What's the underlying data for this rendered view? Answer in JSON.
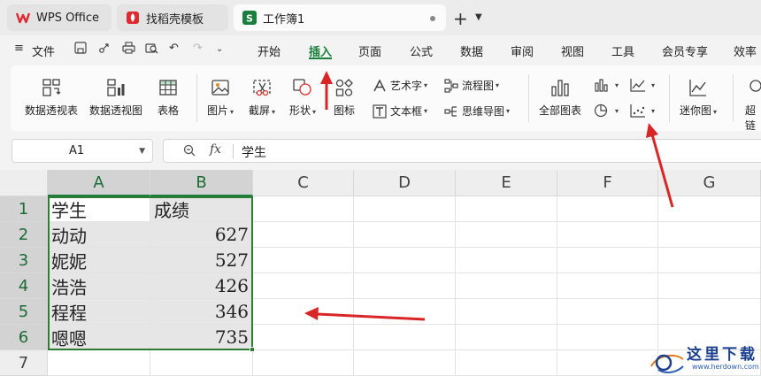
{
  "tabs": [
    {
      "label": "WPS Office",
      "icon": "wps-logo-icon"
    },
    {
      "label": "找稻壳模板",
      "icon": "docer-icon"
    },
    {
      "label": "工作簿1",
      "icon": "spreadsheet-icon"
    }
  ],
  "menu": {
    "file": "文件",
    "items": [
      "开始",
      "插入",
      "页面",
      "公式",
      "数据",
      "审阅",
      "视图",
      "工具",
      "会员专享",
      "效率"
    ],
    "active": "插入"
  },
  "ribbon": {
    "pivot_table": "数据透视表",
    "pivot_chart": "数据透视图",
    "table": "表格",
    "picture": "图片",
    "screenshot": "截屏",
    "shape": "形状",
    "icon": "图标",
    "wordart": "艺术字",
    "textbox": "文本框",
    "flowchart": "流程图",
    "mindmap": "思维导图",
    "all_charts": "全部图表",
    "sparkline": "迷你图",
    "cut_off": "超链"
  },
  "formula_bar": {
    "cell_ref": "A1",
    "fx": "fx",
    "content": "学生"
  },
  "sheet": {
    "columns": [
      "A",
      "B",
      "C",
      "D",
      "E",
      "F",
      "G"
    ],
    "rows": [
      "1",
      "2",
      "3",
      "4",
      "5",
      "6",
      "7"
    ],
    "header": [
      "学生",
      "成绩"
    ],
    "data": [
      [
        "动动",
        "627"
      ],
      [
        "妮妮",
        "527"
      ],
      [
        "浩浩",
        "426"
      ],
      [
        "程程",
        "346"
      ],
      [
        "嗯嗯",
        "735"
      ]
    ]
  },
  "watermark": {
    "text": "这里下载",
    "url": "www.herdown.com"
  },
  "colors": {
    "accent": "#1a7f3c",
    "selection": "#2e7d32",
    "annotation": "#d92525",
    "wps_red": "#e0282e"
  }
}
